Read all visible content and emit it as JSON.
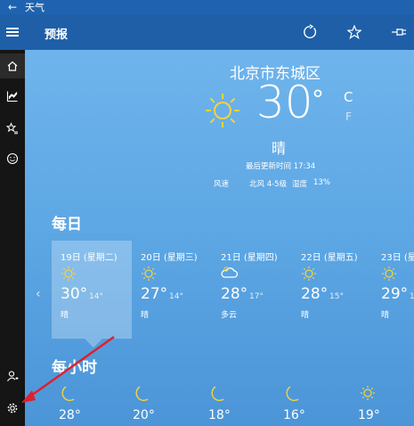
{
  "titlebar": {
    "back_glyph": "←",
    "app_name": "天气"
  },
  "header": {
    "page_title": "预报"
  },
  "sidebar": {
    "items": [
      "home",
      "charts",
      "favorites",
      "feedback",
      "account",
      "settings"
    ]
  },
  "current": {
    "city": "北京市东城区",
    "temp": "30",
    "deg": "°",
    "unit_c": "C",
    "unit_f": "F",
    "condition": "晴",
    "updated": "最后更新时间 17:34",
    "wind_label": "风速",
    "wind_value": "北风 4-5级",
    "humidity_label": "湿度",
    "humidity_value": "13%"
  },
  "daily": {
    "title": "每日",
    "days": [
      {
        "label": "19日 (星期二)",
        "hi": "30°",
        "lo": "14°",
        "cond": "晴",
        "icon": "sun-icon"
      },
      {
        "label": "20日 (星期三)",
        "hi": "27°",
        "lo": "14°",
        "cond": "晴",
        "icon": "sun-icon"
      },
      {
        "label": "21日 (星期四)",
        "hi": "28°",
        "lo": "17°",
        "cond": "多云",
        "icon": "cloud-icon"
      },
      {
        "label": "22日 (星期五)",
        "hi": "28°",
        "lo": "15°",
        "cond": "晴",
        "icon": "sun-icon"
      },
      {
        "label": "23日 (星期",
        "hi": "29°",
        "lo": "1",
        "cond": "晴",
        "icon": "sun-icon"
      }
    ]
  },
  "hourly": {
    "title": "每小时",
    "temps": [
      "28°",
      "20°",
      "18°",
      "16°",
      "19°"
    ],
    "icons": [
      "moon-icon",
      "moon-icon",
      "moon-icon",
      "moon-icon",
      "sun-icon"
    ]
  },
  "colors": {
    "accent": "#1e5fa8",
    "sidebar": "#151515",
    "sun": "#f6d33c",
    "arrow": "#e0202a"
  }
}
